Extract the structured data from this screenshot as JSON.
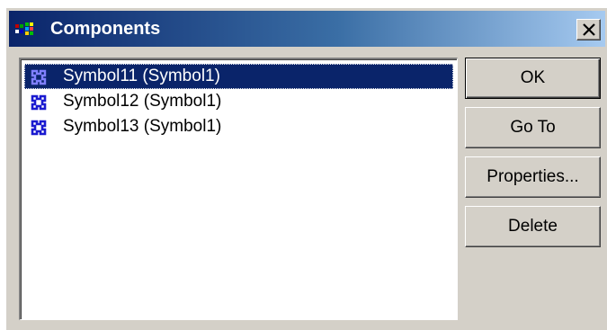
{
  "window": {
    "title": "Components",
    "title_icon": "components-app-icon",
    "close_icon": "close-icon",
    "colors": {
      "face": "#d4d0c8",
      "title_start": "#0a246a",
      "title_end": "#a6caf0",
      "selection": "#0a246a",
      "item_icon": "#1a1ad0"
    }
  },
  "list": {
    "items": [
      {
        "label": "Symbol11 (Symbol1)",
        "icon": "symbol-icon",
        "selected": true
      },
      {
        "label": "Symbol12 (Symbol1)",
        "icon": "symbol-icon",
        "selected": false
      },
      {
        "label": "Symbol13 (Symbol1)",
        "icon": "symbol-icon",
        "selected": false
      }
    ]
  },
  "buttons": {
    "ok": "OK",
    "goto": "Go To",
    "properties": "Properties...",
    "delete": "Delete"
  }
}
